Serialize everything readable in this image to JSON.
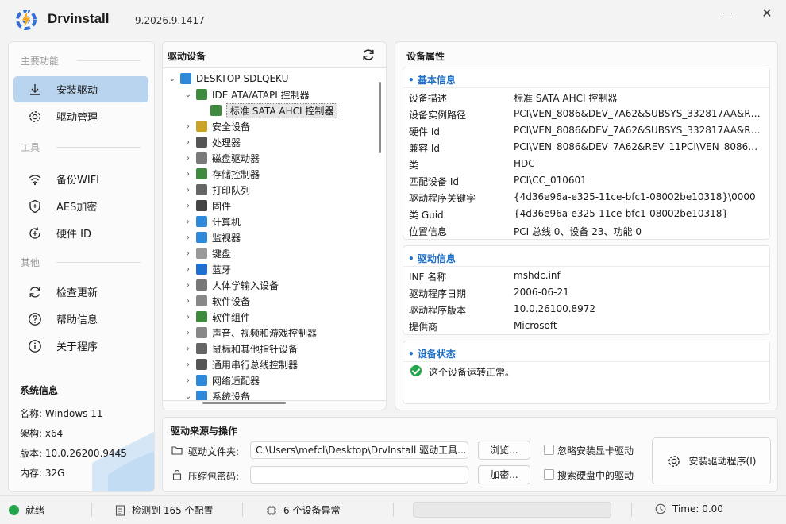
{
  "app": {
    "title": "Drvinstall",
    "version": "9.2026.9.1417",
    "close_glyph": "✕"
  },
  "sidebar": {
    "sections": {
      "main": "主要功能",
      "tools": "工具",
      "other": "其他"
    },
    "items": [
      {
        "label": "安装驱动",
        "icon": "download-icon",
        "active": true
      },
      {
        "label": "驱动管理",
        "icon": "gear-icon"
      },
      {
        "label": "备份WIFI",
        "icon": "wifi-icon"
      },
      {
        "label": "AES加密",
        "icon": "shield-icon"
      },
      {
        "label": "硬件 ID",
        "icon": "hardware-id-icon"
      },
      {
        "label": "检查更新",
        "icon": "refresh-icon"
      },
      {
        "label": "帮助信息",
        "icon": "help-icon"
      },
      {
        "label": "关于程序",
        "icon": "info-icon"
      }
    ],
    "sysinfo": {
      "title": "系统信息",
      "rows": [
        "名称: Windows 11",
        "架构: x64",
        "版本: 10.0.26200.9445",
        "内存: 32G"
      ]
    }
  },
  "tree": {
    "title": "驱动设备",
    "root": "DESKTOP-SDLQEKU",
    "rows": [
      {
        "label": "IDE ATA/ATAPI 控制器",
        "level": 1,
        "chev": "⌄",
        "icon_color": "#3f8a3f"
      },
      {
        "label": "标准 SATA AHCI 控制器",
        "level": 2,
        "chev": "",
        "icon_color": "#3f8a3f",
        "selected": true
      },
      {
        "label": "安全设备",
        "level": 1,
        "chev": "›",
        "icon_color": "#c9a227"
      },
      {
        "label": "处理器",
        "level": 1,
        "chev": "›",
        "icon_color": "#555555"
      },
      {
        "label": "磁盘驱动器",
        "level": 1,
        "chev": "›",
        "icon_color": "#7a7a7a"
      },
      {
        "label": "存储控制器",
        "level": 1,
        "chev": "›",
        "icon_color": "#3f8a3f"
      },
      {
        "label": "打印队列",
        "level": 1,
        "chev": "›",
        "icon_color": "#666666"
      },
      {
        "label": "固件",
        "level": 1,
        "chev": "›",
        "icon_color": "#444444"
      },
      {
        "label": "计算机",
        "level": 1,
        "chev": "›",
        "icon_color": "#2f89d8"
      },
      {
        "label": "监视器",
        "level": 1,
        "chev": "›",
        "icon_color": "#2f89d8"
      },
      {
        "label": "键盘",
        "level": 1,
        "chev": "›",
        "icon_color": "#999999"
      },
      {
        "label": "蓝牙",
        "level": 1,
        "chev": "›",
        "icon_color": "#1f6fd1"
      },
      {
        "label": "人体学输入设备",
        "level": 1,
        "chev": "›",
        "icon_color": "#777777"
      },
      {
        "label": "软件设备",
        "level": 1,
        "chev": "›",
        "icon_color": "#888888"
      },
      {
        "label": "软件组件",
        "level": 1,
        "chev": "›",
        "icon_color": "#3f8a3f"
      },
      {
        "label": "声音、视频和游戏控制器",
        "level": 1,
        "chev": "›",
        "icon_color": "#888888"
      },
      {
        "label": "鼠标和其他指针设备",
        "level": 1,
        "chev": "›",
        "icon_color": "#666666"
      },
      {
        "label": "通用串行总线控制器",
        "level": 1,
        "chev": "›",
        "icon_color": "#555555"
      },
      {
        "label": "网络适配器",
        "level": 1,
        "chev": "›",
        "icon_color": "#2f89d8"
      },
      {
        "label": "系统设备",
        "level": 1,
        "chev": "⌄",
        "icon_color": "#2f89d8"
      }
    ]
  },
  "props": {
    "title": "设备属性",
    "basic": {
      "title": "• 基本信息",
      "rows": [
        [
          "设备描述",
          "标准 SATA AHCI 控制器"
        ],
        [
          "设备实例路径",
          "PCI\\VEN_8086&DEV_7A62&SUBSYS_332817AA&REV..."
        ],
        [
          "硬件 Id",
          "PCI\\VEN_8086&DEV_7A62&SUBSYS_332817AA&REV..."
        ],
        [
          "兼容 Id",
          "PCI\\VEN_8086&DEV_7A62&REV_11PCI\\VEN_8086&D..."
        ],
        [
          "类",
          "HDC"
        ],
        [
          "匹配设备 Id",
          "PCI\\CC_010601"
        ],
        [
          "驱动程序关键字",
          "{4d36e96a-e325-11ce-bfc1-08002be10318}\\0000"
        ],
        [
          "类 Guid",
          "{4d36e96a-e325-11ce-bfc1-08002be10318}"
        ],
        [
          "位置信息",
          "PCI 总线 0、设备 23、功能 0"
        ]
      ]
    },
    "driver": {
      "title": "• 驱动信息",
      "rows": [
        [
          "INF 名称",
          "mshdc.inf"
        ],
        [
          "驱动程序日期",
          "2006-06-21"
        ],
        [
          "驱动程序版本",
          "10.0.26100.8972"
        ],
        [
          "提供商",
          "Microsoft"
        ]
      ]
    },
    "status": {
      "title": "• 设备状态",
      "text": "这个设备运转正常。"
    }
  },
  "source": {
    "title": "驱动来源与操作",
    "folder_label": "驱动文件夹:",
    "folder_value": "C:\\Users\\mefcl\\Desktop\\DrvInstall 驱动工具...",
    "browse_label": "浏览...",
    "password_label": "压缩包密码:",
    "password_value": "",
    "encrypt_label": "加密...",
    "chk_gpu": "忽略安装显卡驱动",
    "chk_search": "搜索硬盘中的驱动",
    "install_label": "安装驱动程序(I)"
  },
  "statusbar": {
    "ready": "就绪",
    "detected": "检测到 165 个配置",
    "abnormal": "6 个设备异常",
    "time": "Time: 0.00",
    "progress": 0
  }
}
